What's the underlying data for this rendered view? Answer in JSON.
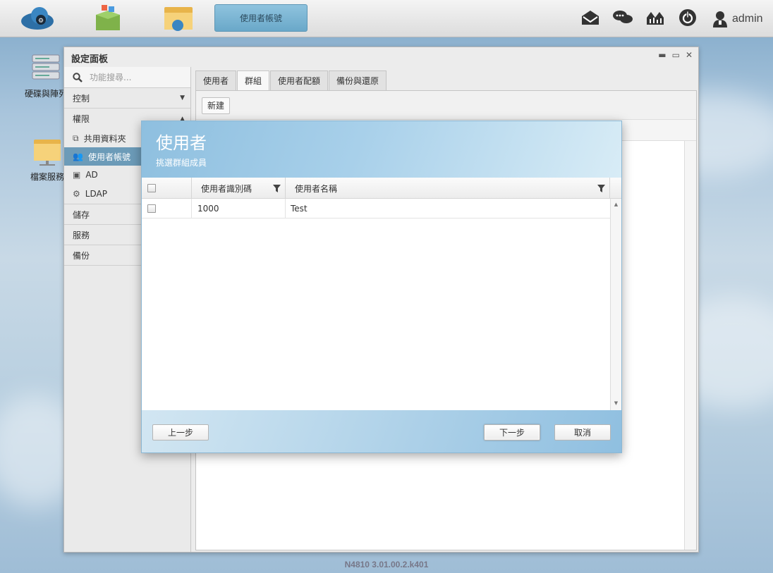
{
  "topbar": {
    "active_app_label": "使用者帳號",
    "user_name": "admin"
  },
  "desktop": {
    "icons": [
      {
        "label": "硬碟與陣列"
      },
      {
        "label": "檔案服務"
      }
    ]
  },
  "window": {
    "title": "設定面板",
    "search_placeholder": "功能搜尋...",
    "sidebar": {
      "sections": [
        {
          "label": "控制",
          "expanded": false
        },
        {
          "label": "權限",
          "expanded": true
        },
        {
          "label": "儲存",
          "expanded": false
        },
        {
          "label": "服務",
          "expanded": false
        },
        {
          "label": "備份",
          "expanded": false
        }
      ],
      "items": [
        {
          "label": "共用資料夾"
        },
        {
          "label": "使用者帳號",
          "active": true
        },
        {
          "label": "AD"
        },
        {
          "label": "LDAP"
        }
      ]
    },
    "tabs": [
      {
        "label": "使用者"
      },
      {
        "label": "群組",
        "active": true
      },
      {
        "label": "使用者配額"
      },
      {
        "label": "備份與還原"
      }
    ],
    "new_button": "新建"
  },
  "dialog": {
    "title": "使用者",
    "subtitle": "挑選群組成員",
    "columns": [
      "使用者識別碼",
      "使用者名稱"
    ],
    "rows": [
      {
        "id": "1000",
        "name": "Test",
        "checked": false
      }
    ],
    "buttons": {
      "prev": "上一步",
      "next": "下一步",
      "cancel": "取消"
    }
  },
  "footer": {
    "version": "N4810   3.01.00.2.k401"
  },
  "colors": {
    "accent": "#6c9bb8",
    "dialog_header": "#8ebfdf"
  }
}
